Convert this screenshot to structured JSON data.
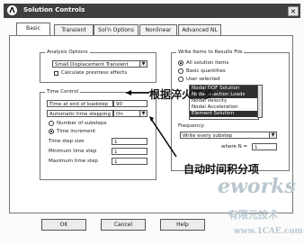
{
  "window": {
    "title": "Solution Controls",
    "close_glyph": "×"
  },
  "tabs": [
    "Basic",
    "Transient",
    "Sol'n Options",
    "Nonlinear",
    "Advanced NL"
  ],
  "analysis_options": {
    "title": "Analysis Options",
    "type_value": "Small Displacement Transient",
    "prestress_label": "Calculate prestress effects"
  },
  "time_control": {
    "title": "Time Control",
    "time_end_label": "Time at end of loadstep",
    "time_end_value": "90",
    "auto_stepping_label": "Automatic time stepping",
    "auto_stepping_value": "On",
    "substeps_label": "Number of substeps",
    "increment_label": "Time increment",
    "time_step_label": "Time step size",
    "time_step_value": "1",
    "min_step_label": "Minimum time step",
    "min_step_value": "1",
    "max_step_label": "Maximum time step",
    "max_step_value": "1"
  },
  "write_items": {
    "title": "Write Items to Results File",
    "all_items_label": "All solution items",
    "basic_label": "Basic quantities",
    "user_label": "User selected",
    "list_items": [
      "Nodal DOF Solution",
      "Nodal Reaction Loads",
      "Nodal Velocity",
      "Nodal Acceleration",
      "Element Solution"
    ],
    "frequency_label": "Frequency:",
    "frequency_value": "Write every substep",
    "where_label": "where N =",
    "where_value": "1"
  },
  "annotations": {
    "top": "根据淬火工步",
    "bottom": "自动时间积分项"
  },
  "watermark": {
    "brand": "eworks",
    "cn": "有限元技术",
    "url": "www.1CAE.com"
  },
  "buttons": {
    "ok": "OK",
    "cancel": "Cancel",
    "help": "Help"
  }
}
